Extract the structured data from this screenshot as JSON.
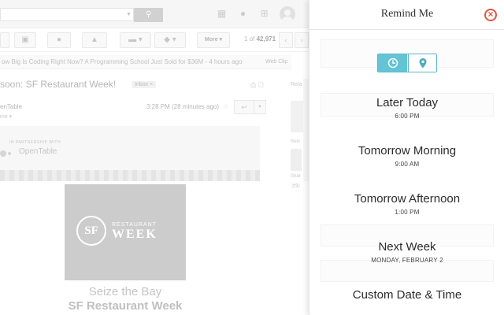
{
  "gmail": {
    "pager_text": "1 of",
    "pager_total": "42,971",
    "more_label": "More",
    "webclip_text": "ow Big Is Coding Right Now? A Programming School Just Sold for $36M - 4 hours ago",
    "webclip_tag": "Web Clip",
    "subject": "soon: SF Restaurant Week!",
    "inbox_label": "Inbox",
    "related_label": "Rela",
    "sender": "enTable",
    "to_line": "me",
    "time": "3:28 PM (28 minutes ago)",
    "partner_label": "IN PARTNERSHIP WITH",
    "opentable_logo": "OpenTable",
    "side_text_1": "Reix",
    "side_text_2": "Shar",
    "side_plus": "+1",
    "sf_initials": "SF",
    "sf_brand_top": "RESTAURANT",
    "sf_brand_bottom": "WEEK",
    "seize": "Seize the Bay",
    "sfrw": "SF Restaurant Week"
  },
  "panel": {
    "title": "Remind Me",
    "toggle_active": "clock",
    "options": [
      {
        "label": "Later Today",
        "sub": "6:00 PM"
      },
      {
        "label": "Tomorrow Morning",
        "sub": "9:00 AM"
      },
      {
        "label": "Tomorrow Afternoon",
        "sub": "1:00 PM"
      },
      {
        "label": "Next Week",
        "sub": "MONDAY, FEBRUARY 2"
      },
      {
        "label": "Custom Date & Time",
        "sub": ""
      }
    ]
  },
  "colors": {
    "accent": "#62c4d4",
    "close": "#e0573f"
  }
}
